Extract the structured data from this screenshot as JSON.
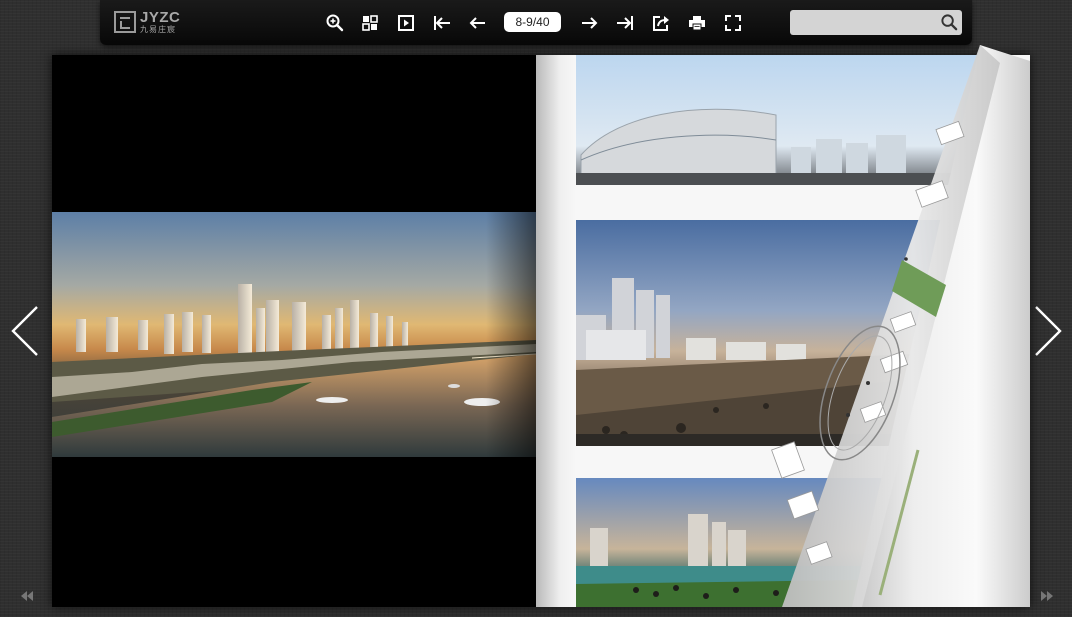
{
  "app": {
    "logo_text": "JYZC",
    "logo_subtext": "九易庄宸"
  },
  "toolbar": {
    "buttons": [
      {
        "name": "zoom-in-icon"
      },
      {
        "name": "thumbnails-icon"
      },
      {
        "name": "autoplay-icon"
      },
      {
        "name": "first-page-icon"
      },
      {
        "name": "previous-page-icon"
      },
      {
        "name": "next-page-icon"
      },
      {
        "name": "last-page-icon"
      },
      {
        "name": "share-icon"
      },
      {
        "name": "print-icon"
      },
      {
        "name": "fullscreen-icon"
      }
    ],
    "page_indicator": "8-9/40"
  },
  "search": {
    "placeholder": "",
    "value": ""
  },
  "colors": {
    "toolbar_bg": "#0c0c0c",
    "background": "#2f2f2f",
    "icon": "#ffffff",
    "search_bg": "#d4d4d4",
    "page_bg": "#f7f7f7"
  }
}
